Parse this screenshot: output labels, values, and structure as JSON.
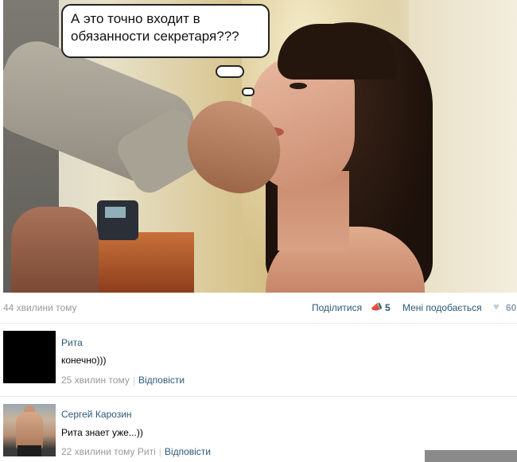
{
  "photo": {
    "caption": "А это точно входит в обязанности секретаря???"
  },
  "post_meta": {
    "time": "44 хвилини тому",
    "share_label": "Поділитися",
    "share_icon": "megaphone-icon",
    "share_count": "5",
    "like_label": "Мені подобається",
    "like_icon": "heart-icon",
    "like_count": "60"
  },
  "comments": [
    {
      "author": "Рита",
      "text": "конечно)))",
      "time": "25 хвилин тому",
      "reply_to": "",
      "reply_label": "Відповісти"
    },
    {
      "author": "Сергей Карозин",
      "text": "Рита знает уже...))",
      "time": "22 хвилини тому",
      "reply_to": "Риті",
      "reply_label": "Відповісти"
    }
  ],
  "colors": {
    "link": "#2b587a",
    "muted": "#999999",
    "divider": "#e7eaed"
  }
}
